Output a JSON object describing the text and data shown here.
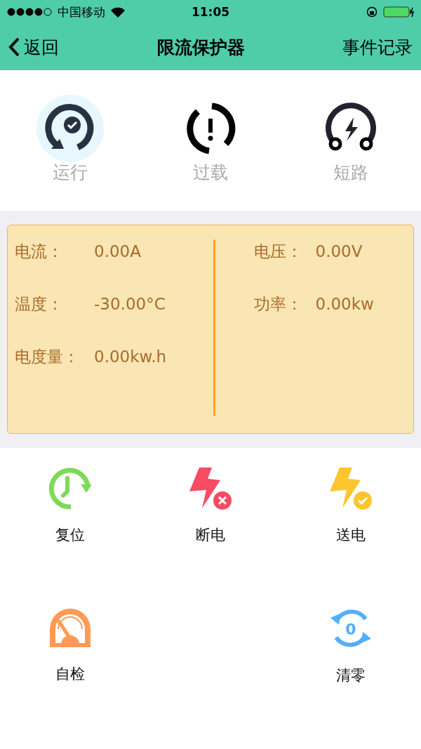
{
  "status_bar": {
    "carrier": "中国移动",
    "time": "11:05"
  },
  "nav": {
    "back": "返回",
    "title": "限流保护器",
    "action": "事件记录"
  },
  "states": [
    {
      "kind": "run",
      "label": "运行",
      "selected": true
    },
    {
      "kind": "overload",
      "label": "过载",
      "selected": false
    },
    {
      "kind": "short",
      "label": "短路",
      "selected": false
    }
  ],
  "readings": {
    "left": [
      {
        "label": "电流：",
        "value": "0.00A"
      },
      {
        "label": "温度：",
        "value": "-30.00°C"
      },
      {
        "label": "电度量：",
        "value": "0.00kw.h"
      }
    ],
    "right": [
      {
        "label": "电压：",
        "value": "0.00V"
      },
      {
        "label": "功率：",
        "value": "0.00kw"
      }
    ]
  },
  "action_rows": [
    [
      {
        "kind": "reset",
        "label": "复位"
      },
      {
        "kind": "cut",
        "label": "断电"
      },
      {
        "kind": "supply",
        "label": "送电"
      }
    ],
    [
      {
        "kind": "selftest",
        "label": "自检"
      },
      null,
      {
        "kind": "clear",
        "label": "清零",
        "badge": "0"
      }
    ]
  ]
}
